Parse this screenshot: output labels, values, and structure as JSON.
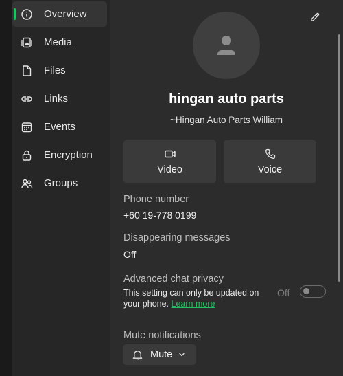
{
  "sidebar": {
    "items": [
      {
        "label": "Overview",
        "icon": "info-icon",
        "active": true
      },
      {
        "label": "Media",
        "icon": "media-icon"
      },
      {
        "label": "Files",
        "icon": "file-icon"
      },
      {
        "label": "Links",
        "icon": "link-icon"
      },
      {
        "label": "Events",
        "icon": "calendar-icon"
      },
      {
        "label": "Encryption",
        "icon": "lock-icon"
      },
      {
        "label": "Groups",
        "icon": "groups-icon"
      }
    ]
  },
  "contact": {
    "name": "hingan auto parts",
    "subtitle": "~Hingan Auto Parts William"
  },
  "actions": {
    "video_label": "Video",
    "voice_label": "Voice"
  },
  "phone": {
    "label": "Phone number",
    "value": "+60 19-778 0199"
  },
  "disappearing": {
    "label": "Disappearing messages",
    "value": "Off"
  },
  "privacy": {
    "label": "Advanced chat privacy",
    "description": "This setting can only be updated on your phone.",
    "learn_more": "Learn more",
    "toggle_state_label": "Off"
  },
  "mute": {
    "label": "Mute notifications",
    "button_label": "Mute"
  },
  "colors": {
    "accent": "#21c063",
    "background": "#2c2c2c",
    "sidebar": "#262626"
  }
}
